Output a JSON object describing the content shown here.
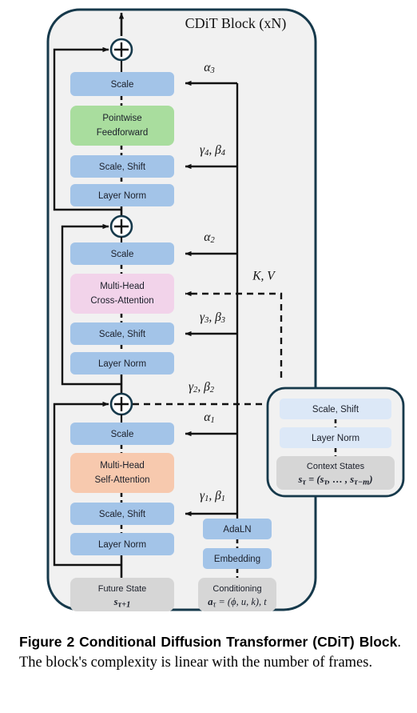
{
  "figure": {
    "title": "CDiT Block (xN)",
    "caption_bold": "Figure 2  Conditional Diffusion Transformer (CDiT) Block",
    "caption_rest": ". The block's complexity is linear with the number of frames."
  },
  "colors": {
    "blue": "#a3c4e8",
    "blue_light": "#dce8f7",
    "green": "#a9dd9e",
    "pink": "#f2d3ea",
    "orange": "#f7c9ae",
    "gray": "#d6d6d6",
    "panel_bg": "#f1f1f1",
    "border": "#16394b",
    "line": "#111111"
  },
  "main_column": {
    "ffn_group": {
      "scale": "Scale",
      "pointwise_l1": "Pointwise",
      "pointwise_l2": "Feedforward",
      "scale_shift": "Scale, Shift",
      "layer_norm": "Layer Norm"
    },
    "cross_attn_group": {
      "scale": "Scale",
      "attn_l1": "Multi-Head",
      "attn_l2": "Cross-Attention",
      "scale_shift": "Scale, Shift",
      "layer_norm": "Layer Norm"
    },
    "self_attn_group": {
      "scale": "Scale",
      "attn_l1": "Multi-Head",
      "attn_l2": "Self-Attention",
      "scale_shift": "Scale, Shift",
      "layer_norm": "Layer Norm"
    },
    "future_state": {
      "label": "Future State",
      "symbol_base": "s",
      "symbol_sub": "τ+1"
    }
  },
  "conditioning_column": {
    "adaln": "AdaLN",
    "embedding": "Embedding",
    "conditioning_label": "Conditioning",
    "conditioning_eq_a": "a",
    "conditioning_eq_sub": "τ",
    "conditioning_eq_rest": " = (ϕ, u, k), t"
  },
  "context_panel": {
    "scale_shift": "Scale, Shift",
    "layer_norm": "Layer Norm",
    "context_label": "Context States",
    "context_eq_s": "s",
    "context_eq_sub": "τ",
    "context_eq_rest": " = (s",
    "context_eq_sub2": "τ",
    "context_eq_mid": ", … , s",
    "context_eq_sub3": "τ−m",
    "context_eq_end": ")"
  },
  "signal_labels": {
    "alpha3": "α",
    "alpha3_sub": "3",
    "gamma4": "γ",
    "gamma4_sub": "4",
    "beta4": "β",
    "beta4_sub": "4",
    "alpha2": "α",
    "alpha2_sub": "2",
    "kv": "K, V",
    "gamma3": "γ",
    "gamma3_sub": "3",
    "beta3": "β",
    "beta3_sub": "3",
    "gamma2": "γ",
    "gamma2_sub": "2",
    "beta2": "β",
    "beta2_sub": "2",
    "alpha1": "α",
    "alpha1_sub": "1",
    "gamma1": "γ",
    "gamma1_sub": "1",
    "beta1": "β",
    "beta1_sub": "1",
    "comma": ","
  },
  "operators": {
    "add1": "⊕",
    "add2": "⊕",
    "add3": "⊕"
  }
}
